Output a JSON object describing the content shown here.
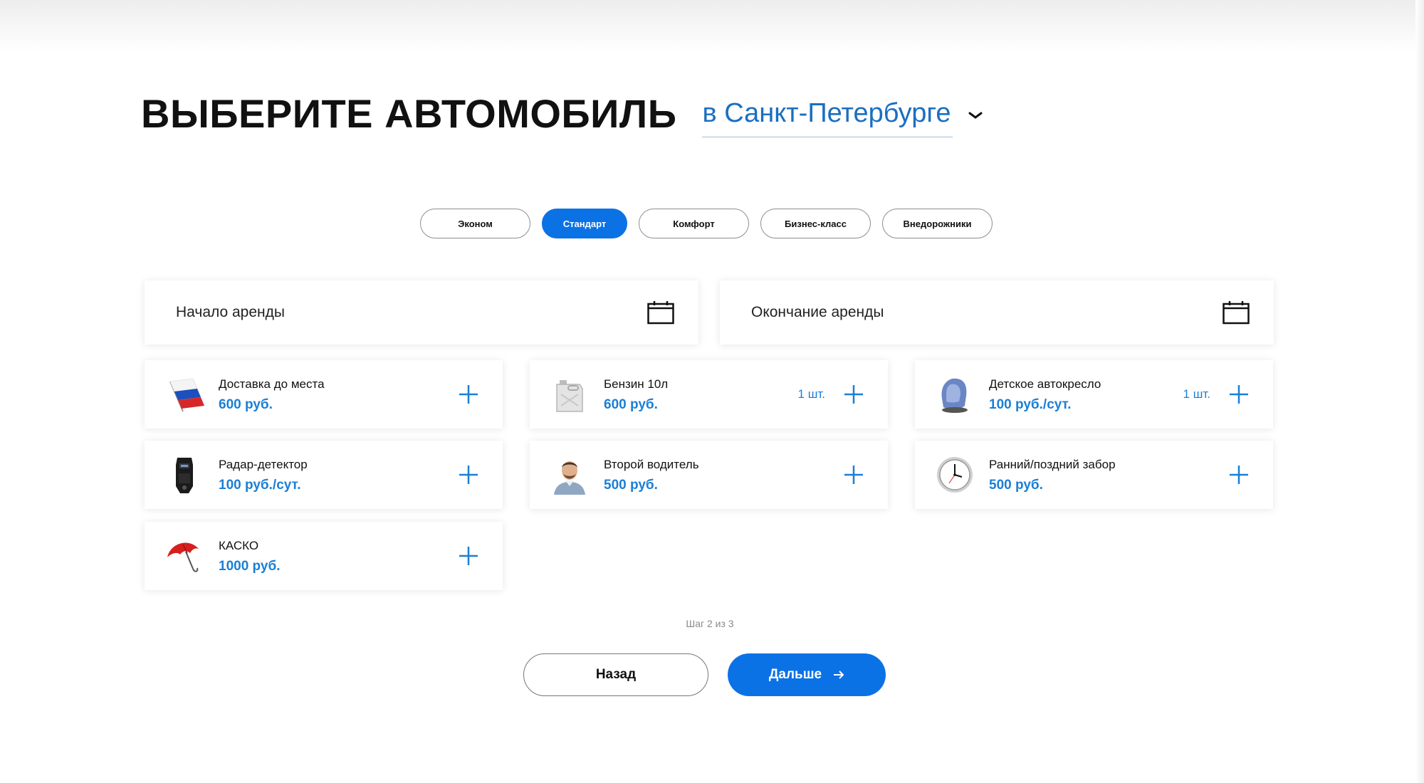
{
  "header": {
    "title": "ВЫБЕРИТЕ АВТОМОБИЛЬ",
    "city": "в Санкт-Петербурге"
  },
  "tabs": [
    {
      "label": "Эконом",
      "active": false
    },
    {
      "label": "Стандарт",
      "active": true
    },
    {
      "label": "Комфорт",
      "active": false
    },
    {
      "label": "Бизнес-класс",
      "active": false
    },
    {
      "label": "Внедорожники",
      "active": false
    }
  ],
  "dates": {
    "start_label": "Начало аренды",
    "end_label": "Окончание аренды"
  },
  "services": [
    {
      "name": "Доставка до места",
      "price": "600 руб.",
      "qty": "",
      "icon": "russian-flag-icon"
    },
    {
      "name": "Бензин 10л",
      "price": "600 руб.",
      "qty": "1 шт.",
      "icon": "fuel-canister-icon"
    },
    {
      "name": "Детское автокресло",
      "price": "100 руб./сут.",
      "qty": "1 шт.",
      "icon": "child-seat-icon"
    },
    {
      "name": "Радар-детектор",
      "price": "100 руб./сут.",
      "qty": "",
      "icon": "radar-detector-icon"
    },
    {
      "name": "Второй водитель",
      "price": "500 руб.",
      "qty": "",
      "icon": "driver-portrait-icon"
    },
    {
      "name": "Ранний/поздний забор",
      "price": "500 руб.",
      "qty": "",
      "icon": "clock-icon"
    },
    {
      "name": "КАСКО",
      "price": "1000 руб.",
      "qty": "",
      "icon": "umbrella-icon"
    }
  ],
  "footer": {
    "step": "Шаг 2 из 3",
    "back_label": "Назад",
    "next_label": "Дальше"
  },
  "colors": {
    "accent": "#0b72e6",
    "link": "#1a6fc0",
    "price": "#1a7fd6"
  }
}
